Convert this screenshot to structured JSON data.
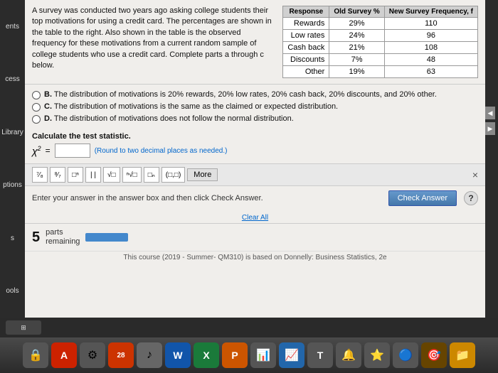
{
  "problem": {
    "text": "A survey was conducted two years ago asking college students their top motivations for using a credit card. The percentages are shown in the table to the right. Also shown in the table is the observed frequency for these motivations from a current random sample of college students who use a credit card. Complete parts a through c below.",
    "table_header": {
      "col1": "Response",
      "col2": "Old Survey %",
      "col3": "New Survey Frequency, f"
    },
    "table_rows": [
      {
        "response": "Rewards",
        "old_pct": "29%",
        "new_freq": "110"
      },
      {
        "response": "Low rates",
        "old_pct": "24%",
        "new_freq": "96"
      },
      {
        "response": "Cash back",
        "old_pct": "21%",
        "new_freq": "108"
      },
      {
        "response": "Discounts",
        "old_pct": "7%",
        "new_freq": "48"
      },
      {
        "response": "Other",
        "old_pct": "19%",
        "new_freq": "63"
      }
    ]
  },
  "choices": [
    {
      "id": "B",
      "text": "The distribution of motivations is 20% rewards, 20% low rates, 20% cash back, 20% discounts, and 20% other."
    },
    {
      "id": "C",
      "text": "The distribution of motivations is the same as the claimed or expected distribution."
    },
    {
      "id": "D",
      "text": "The distribution of motivations does not follow the normal distribution."
    }
  ],
  "calculate": {
    "label": "Calculate the test statistic.",
    "chi_label": "χ²",
    "superscript": "2",
    "equals": "=",
    "round_note": "(Round to two decimal places as needed.)"
  },
  "math_toolbar": {
    "buttons": [
      "frac",
      "sqrt",
      "nth_root",
      "abs",
      "paren",
      "more"
    ],
    "button_labels": [
      "⁷⁄₈",
      "⁸⁄₇",
      "□ⁿ",
      "| |",
      "√□",
      "ⁿ√□",
      "□ₙ",
      "(□,□)",
      "More"
    ],
    "close": "×"
  },
  "answer_section": {
    "instruction": "Enter your answer in the answer box and then click Check Answer.",
    "clear_all": "Clear All",
    "check_btn": "Check Answer",
    "help": "?"
  },
  "parts": {
    "number": "5",
    "label_line1": "parts",
    "label_line2": "remaining"
  },
  "course_info": {
    "text": "This course (2019 - Summer- QM310) is based on Donnelly: Business Statistics, 2e"
  },
  "sidebar": {
    "items": [
      "ents",
      "cess",
      "Library",
      "ptions",
      "s",
      "ools"
    ]
  },
  "dock": {
    "items": [
      {
        "icon": "🔒",
        "color": "dark"
      },
      {
        "icon": "A",
        "color": "red"
      },
      {
        "icon": "⚙",
        "color": "dark"
      },
      {
        "icon": "28",
        "color": "dark"
      },
      {
        "icon": "🎵",
        "color": "dark"
      },
      {
        "icon": "W",
        "color": "blue"
      },
      {
        "icon": "X",
        "color": "green"
      },
      {
        "icon": "P",
        "color": "orange"
      },
      {
        "icon": "📊",
        "color": "dark"
      },
      {
        "icon": "📊",
        "color": "blue"
      },
      {
        "icon": "T",
        "color": "dark"
      },
      {
        "icon": "🔔",
        "color": "dark"
      },
      {
        "icon": "⭐",
        "color": "dark"
      },
      {
        "icon": "🔵",
        "color": "dark"
      },
      {
        "icon": "🎯",
        "color": "dark"
      },
      {
        "icon": "📁",
        "color": "gold"
      }
    ]
  }
}
